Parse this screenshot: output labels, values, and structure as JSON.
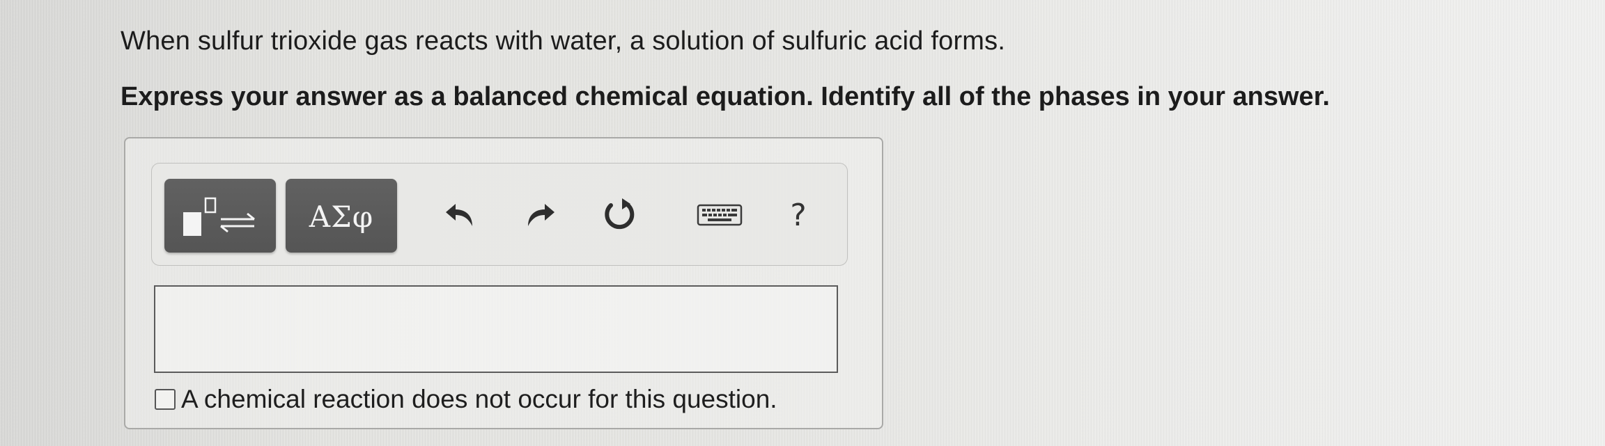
{
  "question": {
    "text": "When sulfur trioxide gas reacts with water, a solution of sulfuric acid forms.",
    "instruction": "Express your answer as a balanced chemical equation. Identify all of the phases in your answer."
  },
  "toolbar": {
    "template_icon": "templates-reaction-arrow-icon",
    "symbols_label": "ΑΣφ",
    "undo_icon": "undo-icon",
    "redo_icon": "redo-icon",
    "reset_icon": "reset-icon",
    "keyboard_icon": "keyboard-icon",
    "help_label": "?"
  },
  "answer": {
    "value": "",
    "checkbox_label": "A chemical reaction does not occur for this question.",
    "checkbox_checked": false
  },
  "colors": {
    "tool_button_bg": "#5b5b5b",
    "tool_button_text": "#f2f2f2",
    "panel_border": "#a9a9a7",
    "input_border": "#5b5b5b"
  }
}
